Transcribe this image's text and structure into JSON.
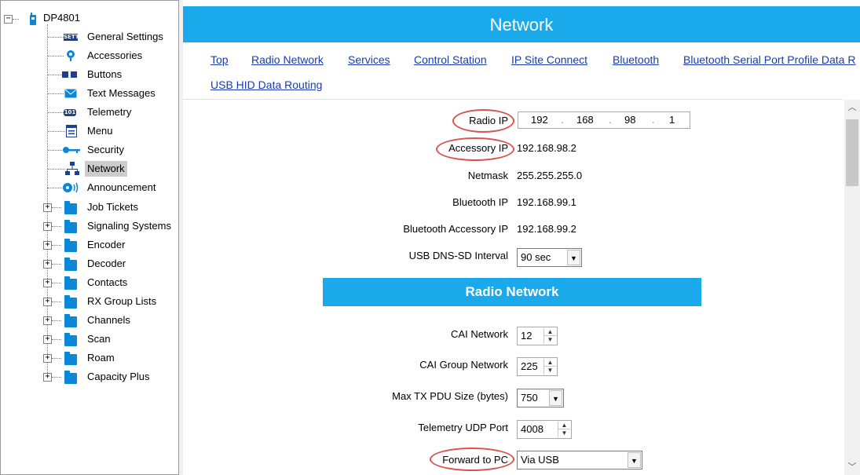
{
  "tree": {
    "root": "DP4801",
    "items": [
      {
        "label": "General Settings",
        "icon": "settings-icon"
      },
      {
        "label": "Accessories",
        "icon": "accessory-icon"
      },
      {
        "label": "Buttons",
        "icon": "buttons-icon"
      },
      {
        "label": "Text Messages",
        "icon": "envelope-icon"
      },
      {
        "label": "Telemetry",
        "icon": "telemetry-icon"
      },
      {
        "label": "Menu",
        "icon": "menu-icon"
      },
      {
        "label": "Security",
        "icon": "key-icon"
      },
      {
        "label": "Network",
        "icon": "network-icon"
      },
      {
        "label": "Announcement",
        "icon": "announcement-icon"
      }
    ],
    "folders": [
      "Job Tickets",
      "Signaling Systems",
      "Encoder",
      "Decoder",
      "Contacts",
      "RX Group Lists",
      "Channels",
      "Scan",
      "Roam",
      "Capacity Plus"
    ],
    "selected": "Network",
    "settings_icon_text": "SETTI",
    "telemetry_icon_text": "101"
  },
  "header": {
    "title": "Network"
  },
  "nav": {
    "links": [
      "Top",
      "Radio Network",
      "Services",
      "Control Station",
      "IP Site Connect",
      "Bluetooth",
      "Bluetooth Serial Port Profile Data R",
      "USB HID Data Routing"
    ]
  },
  "form": {
    "radio_ip_label": "Radio IP",
    "radio_ip": [
      "192",
      "168",
      "98",
      "1"
    ],
    "accessory_ip_label": "Accessory IP",
    "accessory_ip": "192.168.98.2",
    "netmask_label": "Netmask",
    "netmask": "255.255.255.0",
    "bluetooth_ip_label": "Bluetooth IP",
    "bluetooth_ip": "192.168.99.1",
    "bluetooth_accessory_ip_label": "Bluetooth Accessory IP",
    "bluetooth_accessory_ip": "192.168.99.2",
    "usb_dns_label": "USB DNS-SD Interval",
    "usb_dns": "90 sec"
  },
  "radio_network": {
    "title": "Radio Network",
    "cai_network_label": "CAI Network",
    "cai_network": "12",
    "cai_group_network_label": "CAI Group Network",
    "cai_group_network": "225",
    "max_tx_label": "Max TX PDU Size (bytes)",
    "max_tx": "750",
    "telemetry_udp_label": "Telemetry UDP Port",
    "telemetry_udp": "4008",
    "forward_label": "Forward to PC",
    "forward": "Via USB"
  },
  "colors": {
    "accent": "#1aa9eb",
    "highlight_ring": "#d9534f",
    "link": "#1a3ca8"
  }
}
